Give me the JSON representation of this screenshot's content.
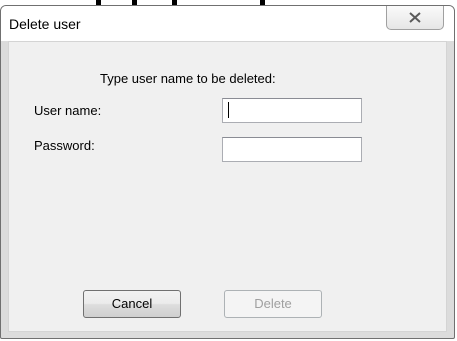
{
  "window": {
    "title": "Delete user",
    "close_icon": "close-x-icon"
  },
  "form": {
    "prompt": "Type user name to be deleted:",
    "username_label": "User name:",
    "username_value": "",
    "password_label": "Password:",
    "password_value": ""
  },
  "buttons": {
    "cancel_label": "Cancel",
    "delete_label": "Delete",
    "delete_enabled": false
  },
  "colors": {
    "dialog_frame": "#dcdcdc",
    "client_background": "#f0f0f0",
    "disabled_text": "#a0a0a0"
  }
}
